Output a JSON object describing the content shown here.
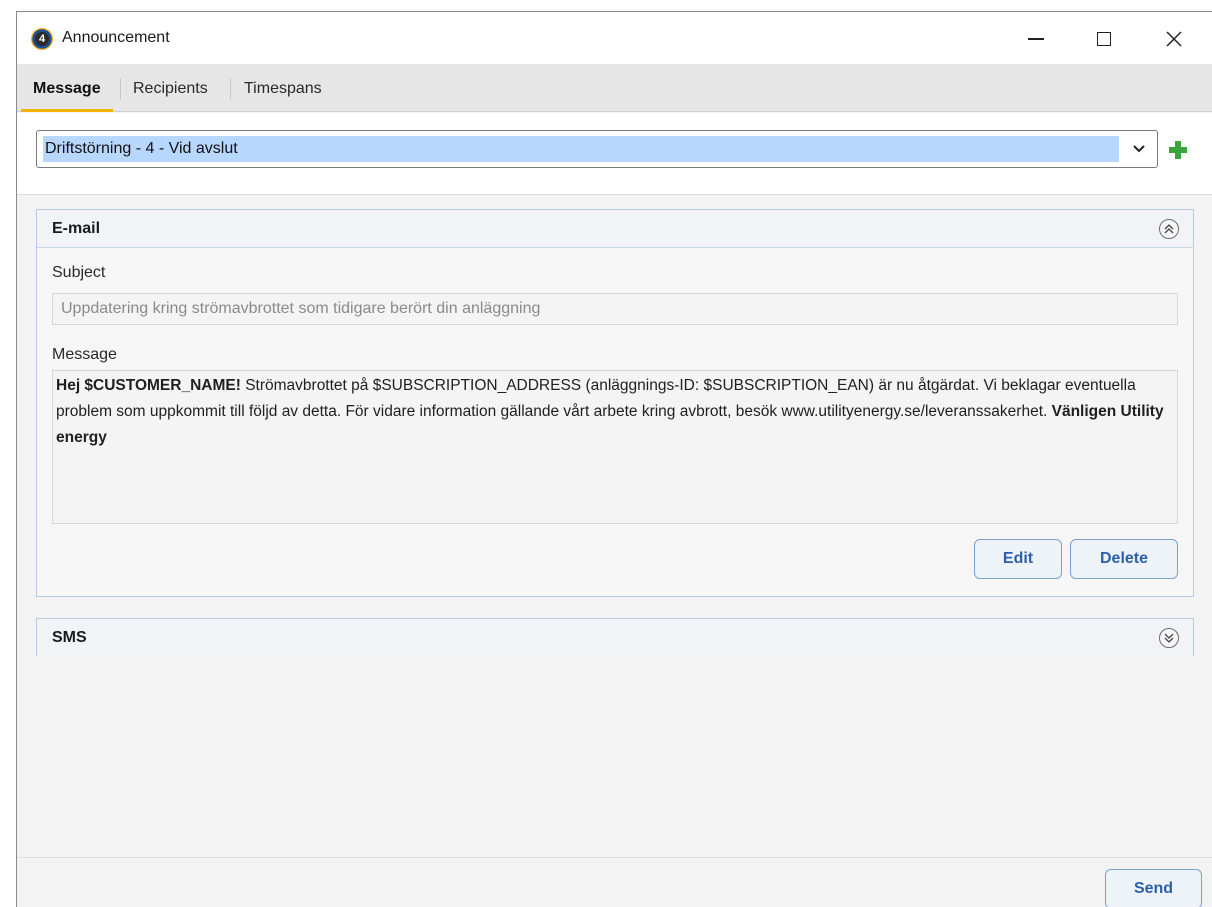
{
  "window": {
    "title": "Announcement",
    "app_icon": "utility-energy-logo-icon",
    "controls": [
      "minimize-icon",
      "maximize-icon",
      "close-icon"
    ]
  },
  "tabs": [
    {
      "label": "Message",
      "active": true
    },
    {
      "label": "Recipients",
      "active": false
    },
    {
      "label": "Timespans",
      "active": false
    }
  ],
  "template": {
    "selected": "Driftstörning - 4 - Vid avslut",
    "add_icon": "plus-icon"
  },
  "email": {
    "header": "E-mail",
    "expanded": true,
    "subject_label": "Subject",
    "subject_value": "Uppdatering kring strömavbrottet som tidigare berört din anläggning",
    "message_label": "Message",
    "message": {
      "greeting": "Hej $CUSTOMER_NAME!",
      "body": " Strömavbrottet på $SUBSCRIPTION_ADDRESS (anläggnings-ID: $SUBSCRIPTION_EAN) är nu åtgärdat. Vi beklagar eventuella problem som uppkommit till följd av detta. För vidare information gällande vårt arbete kring avbrott, besök www.utilityenergy.se/leveranssakerhet. ",
      "signature": "Vänligen Utility energy"
    },
    "edit_label": "Edit",
    "delete_label": "Delete"
  },
  "sms": {
    "header": "SMS",
    "expanded": false
  },
  "footer": {
    "send_label": "Send"
  },
  "colors": {
    "tab_accent": "#f0b400",
    "selection_highlight": "#b8d7ff",
    "button_text": "#2d5fa8",
    "add_icon": "#3aa53a"
  }
}
